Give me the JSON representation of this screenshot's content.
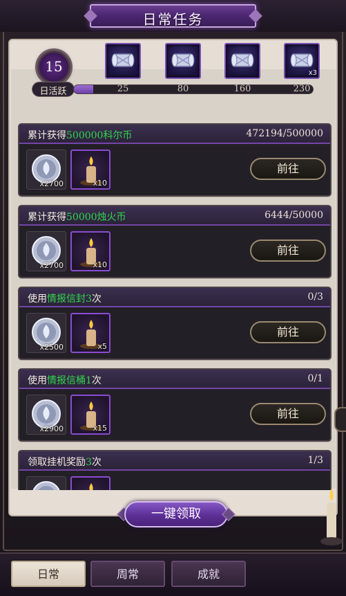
{
  "header": {
    "title": "日常任务"
  },
  "activity": {
    "value": "15",
    "label": "日活跃",
    "progress_fraction": 0.08,
    "milestones": [
      "25",
      "80",
      "160",
      "230"
    ],
    "chests": [
      {
        "icon": "scroll-chest-icon",
        "count": ""
      },
      {
        "icon": "scroll-chest-icon",
        "count": ""
      },
      {
        "icon": "scroll-chest-icon",
        "count": ""
      },
      {
        "icon": "scroll-chest-icon",
        "count": "x3"
      }
    ]
  },
  "tasks": [
    {
      "prefix": "累计获得",
      "highlight": "500000科尔币",
      "suffix": "",
      "progress": "472194/500000",
      "rewards": [
        {
          "icon": "silver-coin-icon",
          "count": "x2700"
        },
        {
          "icon": "candle-icon",
          "count": "x10"
        }
      ],
      "button": "前往"
    },
    {
      "prefix": "累计获得",
      "highlight": "50000烛火币",
      "suffix": "",
      "progress": "6444/50000",
      "rewards": [
        {
          "icon": "silver-coin-icon",
          "count": "x2700"
        },
        {
          "icon": "candle-icon",
          "count": "x10"
        }
      ],
      "button": "前往"
    },
    {
      "prefix": "使用",
      "highlight": "情报信封3",
      "suffix": "次",
      "progress": "0/3",
      "rewards": [
        {
          "icon": "silver-coin-icon",
          "count": "x2500"
        },
        {
          "icon": "candle-icon",
          "count": "x5"
        }
      ],
      "button": "前往"
    },
    {
      "prefix": "使用",
      "highlight": "情报信桶1",
      "suffix": "次",
      "progress": "0/1",
      "rewards": [
        {
          "icon": "silver-coin-icon",
          "count": "x2900"
        },
        {
          "icon": "candle-icon",
          "count": "x15"
        }
      ],
      "button": "前往"
    },
    {
      "prefix": "领取挂机奖励",
      "highlight": "3",
      "suffix": "次",
      "progress": "1/3",
      "rewards": [
        {
          "icon": "silver-coin-icon",
          "count": ""
        },
        {
          "icon": "candle-icon",
          "count": ""
        }
      ],
      "button": ""
    }
  ],
  "claim_all": {
    "label": "一键领取"
  },
  "tabs": [
    {
      "label": "日常",
      "active": true
    },
    {
      "label": "周常",
      "active": false
    },
    {
      "label": "成就",
      "active": false
    }
  ],
  "colors": {
    "accent_purple": "#7445a8",
    "highlight_green": "#2fd64a",
    "paper": "#e6ded5"
  }
}
